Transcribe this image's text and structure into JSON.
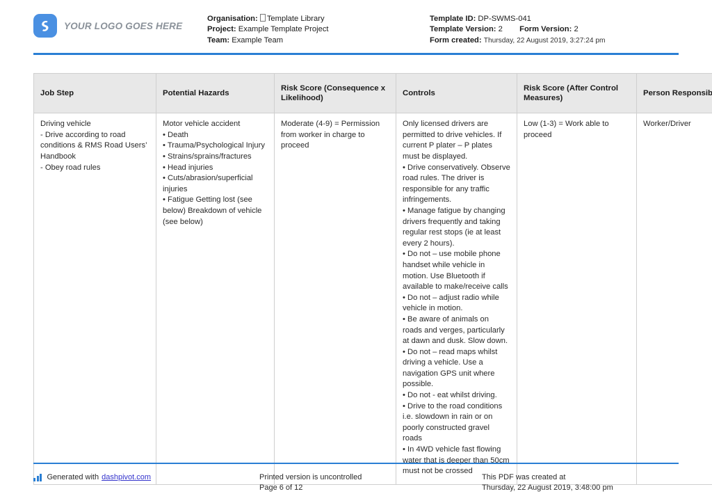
{
  "header": {
    "logo_text": "YOUR LOGO GOES HERE",
    "left_meta": {
      "organisation_label": "Organisation:",
      "organisation_value": "Template Library",
      "project_label": "Project:",
      "project_value": "Example Template Project",
      "team_label": "Team:",
      "team_value": "Example Team"
    },
    "right_meta": {
      "template_id_label": "Template ID:",
      "template_id_value": "DP-SWMS-041",
      "template_version_label": "Template Version:",
      "template_version_value": "2",
      "form_version_label": "Form Version:",
      "form_version_value": "2",
      "form_created_label": "Form created:",
      "form_created_value": "Thursday, 22 August 2019, 3:27:24 pm"
    }
  },
  "table": {
    "columns": [
      "Job Step",
      "Potential Hazards",
      "Risk Score (Consequence x Likelihood)",
      "Controls",
      "Risk Score (After Control Measures)",
      "Person Responsible"
    ],
    "rows": [
      {
        "job_step": "Driving vehicle\n- Drive according to road conditions & RMS Road Users’ Handbook\n- Obey road rules",
        "potential_hazards": "Motor vehicle accident\n• Death\n• Trauma/Psychological Injury\n• Strains/sprains/fractures\n• Head injuries\n• Cuts/abrasion/superficial injuries\n• Fatigue Getting lost (see below) Breakdown of vehicle (see below)",
        "risk_score": "Moderate (4-9) = Permission from worker in charge to proceed",
        "controls": "Only licensed drivers are permitted to drive vehicles. If current P plater – P plates must be displayed.\n• Drive conservatively. Observe road rules. The driver is responsible for any traffic infringements.\n• Manage fatigue by changing drivers frequently and taking regular rest stops (ie at least every 2 hours).\n• Do not – use mobile phone handset while vehicle in motion. Use Bluetooth if available to make/receive calls\n• Do not – adjust radio while vehicle in motion.\n• Be aware of animals on roads and verges, particularly at dawn and dusk. Slow down.\n• Do not – read maps whilst driving a vehicle. Use a navigation GPS unit where possible.\n• Do not - eat whilst driving.\n• Drive to the road conditions i.e. slowdown in rain or on poorly constructed gravel roads\n• In 4WD vehicle fast flowing water that is deeper than 50cm must not be crossed",
        "risk_score_after": "Low (1-3) = Work able to proceed",
        "person_responsible": "Worker/Driver"
      }
    ]
  },
  "footer": {
    "generated_with_prefix": "Generated with",
    "generated_with_link": "dashpivot.com",
    "printed_notice": "Printed version is uncontrolled",
    "page_number": "Page 6 of 12",
    "pdf_created_label": "This PDF was created at",
    "pdf_created_value": "Thursday, 22 August 2019, 3:48:00 pm"
  },
  "colors": {
    "accent_blue": "#2a7fd4",
    "logo_blue": "#4a90e2",
    "header_row_bg": "#e8e8e8",
    "link_blue": "#3333cc",
    "border_grey": "#cfcfcf"
  }
}
